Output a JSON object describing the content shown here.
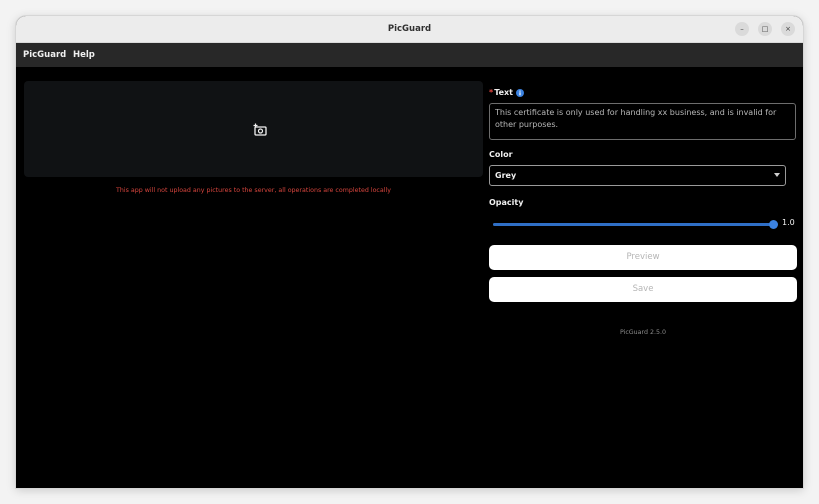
{
  "window": {
    "title": "PicGuard",
    "controls": {
      "minimize": "–",
      "maximize": "□",
      "close": "×"
    }
  },
  "menubar": {
    "items": [
      {
        "label": "PicGuard"
      },
      {
        "label": "Help"
      }
    ]
  },
  "left_panel": {
    "upload_icon": "add-photo-icon",
    "notice": "This app will not upload any pictures to the server, all operations are completed locally"
  },
  "form": {
    "text": {
      "required_mark": "*",
      "label": "Text",
      "info_icon": "info-icon",
      "value": "This certificate is only used for handling xx business, and is invalid for other purposes."
    },
    "color": {
      "label": "Color",
      "selected": "Grey"
    },
    "opacity": {
      "label": "Opacity",
      "value": 1.0,
      "value_label": "1.0",
      "min": 0,
      "max": 1
    },
    "preview_label": "Preview",
    "save_label": "Save"
  },
  "footer": {
    "version": "PicGuard 2.5.0"
  },
  "colors": {
    "accent": "#2f6fc6",
    "notice": "#d6453d",
    "background": "#000000",
    "menubar": "#282828"
  }
}
